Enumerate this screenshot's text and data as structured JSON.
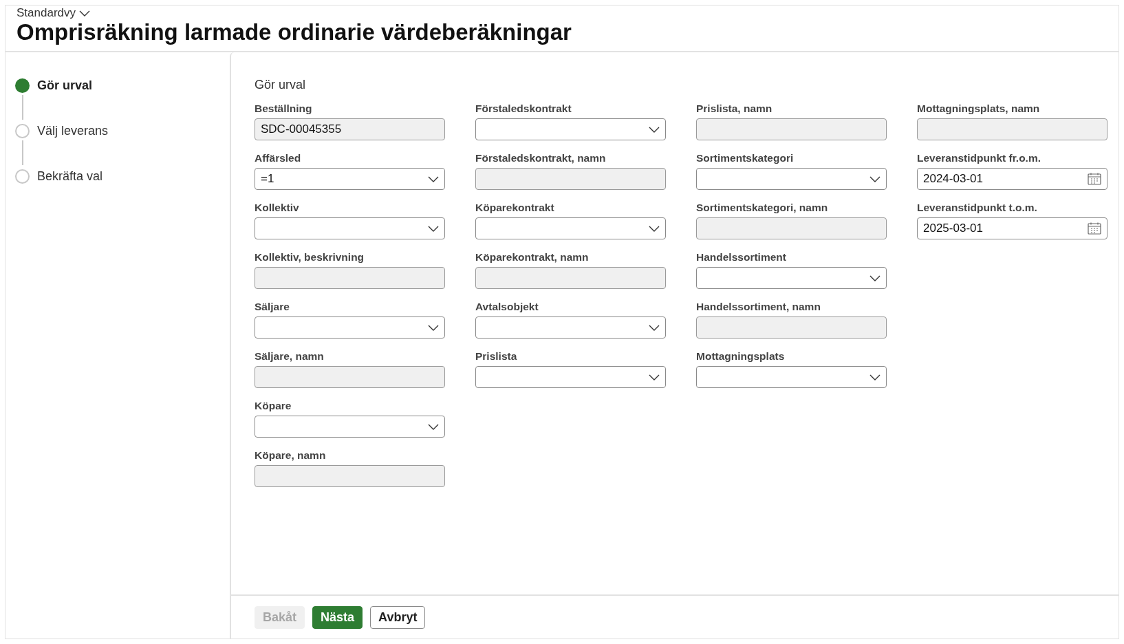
{
  "header": {
    "view_selector": "Standardvy",
    "title": "Omprisräkning larmade ordinarie värdeberäkningar"
  },
  "steps": [
    {
      "label": "Gör urval",
      "selected": true
    },
    {
      "label": "Välj leverans",
      "selected": false
    },
    {
      "label": "Bekräfta val",
      "selected": false
    }
  ],
  "section_title": "Gör urval",
  "columns": [
    [
      {
        "label": "Beställning",
        "kind": "readonly",
        "value": "SDC-00045355"
      },
      {
        "label": "Affärsled",
        "kind": "dropdown",
        "value": "=1"
      },
      {
        "label": "Kollektiv",
        "kind": "dropdown"
      },
      {
        "label": "Kollektiv, beskrivning",
        "kind": "readonly"
      },
      {
        "label": "Säljare",
        "kind": "dropdown"
      },
      {
        "label": "Säljare, namn",
        "kind": "readonly"
      },
      {
        "label": "Köpare",
        "kind": "dropdown"
      },
      {
        "label": "Köpare, namn",
        "kind": "readonly"
      }
    ],
    [
      {
        "label": "Förstaledskontrakt",
        "kind": "dropdown"
      },
      {
        "label": "Förstaledskontrakt, namn",
        "kind": "readonly"
      },
      {
        "label": "Köparekontrakt",
        "kind": "dropdown"
      },
      {
        "label": "Köparekontrakt, namn",
        "kind": "readonly"
      },
      {
        "label": "Avtalsobjekt",
        "kind": "dropdown"
      },
      {
        "label": "Prislista",
        "kind": "dropdown"
      }
    ],
    [
      {
        "label": "Prislista, namn",
        "kind": "readonly"
      },
      {
        "label": "Sortimentskategori",
        "kind": "dropdown"
      },
      {
        "label": "Sortimentskategori, namn",
        "kind": "readonly"
      },
      {
        "label": "Handelssortiment",
        "kind": "dropdown"
      },
      {
        "label": "Handelssortiment, namn",
        "kind": "readonly"
      },
      {
        "label": "Mottagningsplats",
        "kind": "dropdown"
      }
    ],
    [
      {
        "label": "Mottagningsplats, namn",
        "kind": "readonly"
      },
      {
        "label": "Leveranstidpunkt fr.o.m.",
        "kind": "date",
        "value": "2024-03-01"
      },
      {
        "label": "Leveranstidpunkt t.o.m.",
        "kind": "date",
        "value": "2025-03-01"
      }
    ]
  ],
  "buttons": [
    {
      "label": "Bakåt",
      "primary": false,
      "disabled": true
    },
    {
      "label": "Nästa",
      "primary": true,
      "disabled": false
    },
    {
      "label": "Avbryt",
      "primary": false,
      "disabled": false
    }
  ]
}
